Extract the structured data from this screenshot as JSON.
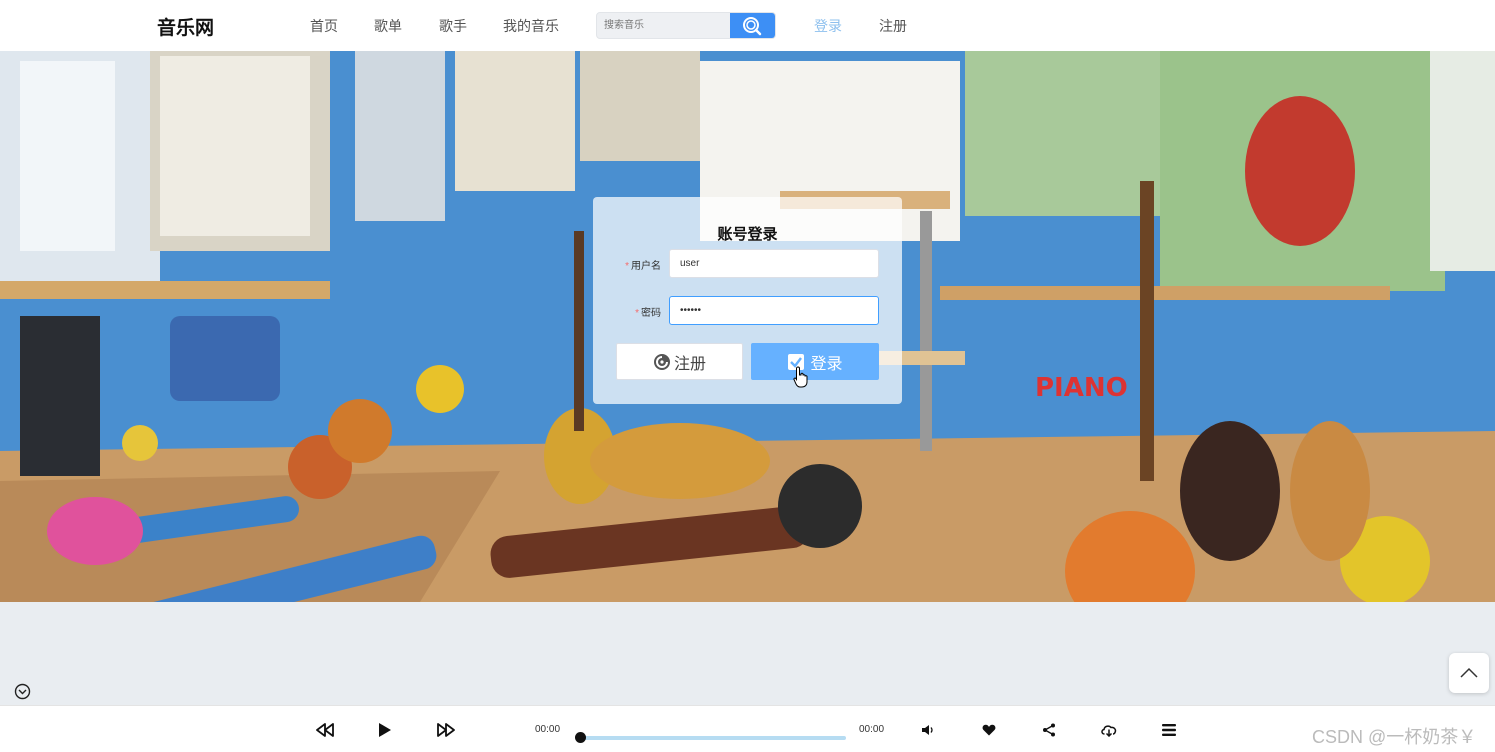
{
  "header": {
    "logo": "音乐网",
    "nav": [
      "首页",
      "歌单",
      "歌手",
      "我的音乐"
    ],
    "search_placeholder": "搜索音乐",
    "login": "登录",
    "register": "注册"
  },
  "login_form": {
    "title": "账号登录",
    "username_label": "用户名",
    "username_value": "user",
    "password_label": "密码",
    "password_value": "••••••",
    "required_mark": "*",
    "register_button": "注册",
    "login_button": "登录"
  },
  "player": {
    "current_time": "00:00",
    "total_time": "00:00",
    "progress": 0,
    "controls": [
      "previous-icon",
      "play-icon",
      "next-icon",
      "volume-icon",
      "like-icon",
      "share-icon",
      "download-icon",
      "playlist-icon"
    ]
  },
  "watermark": "CSDN @一杯奶茶￥",
  "colors": {
    "accent": "#409eff",
    "login_button": "#66b1ff",
    "login_link": "#8ec0ee",
    "progress_track": "#b6dcf2"
  }
}
